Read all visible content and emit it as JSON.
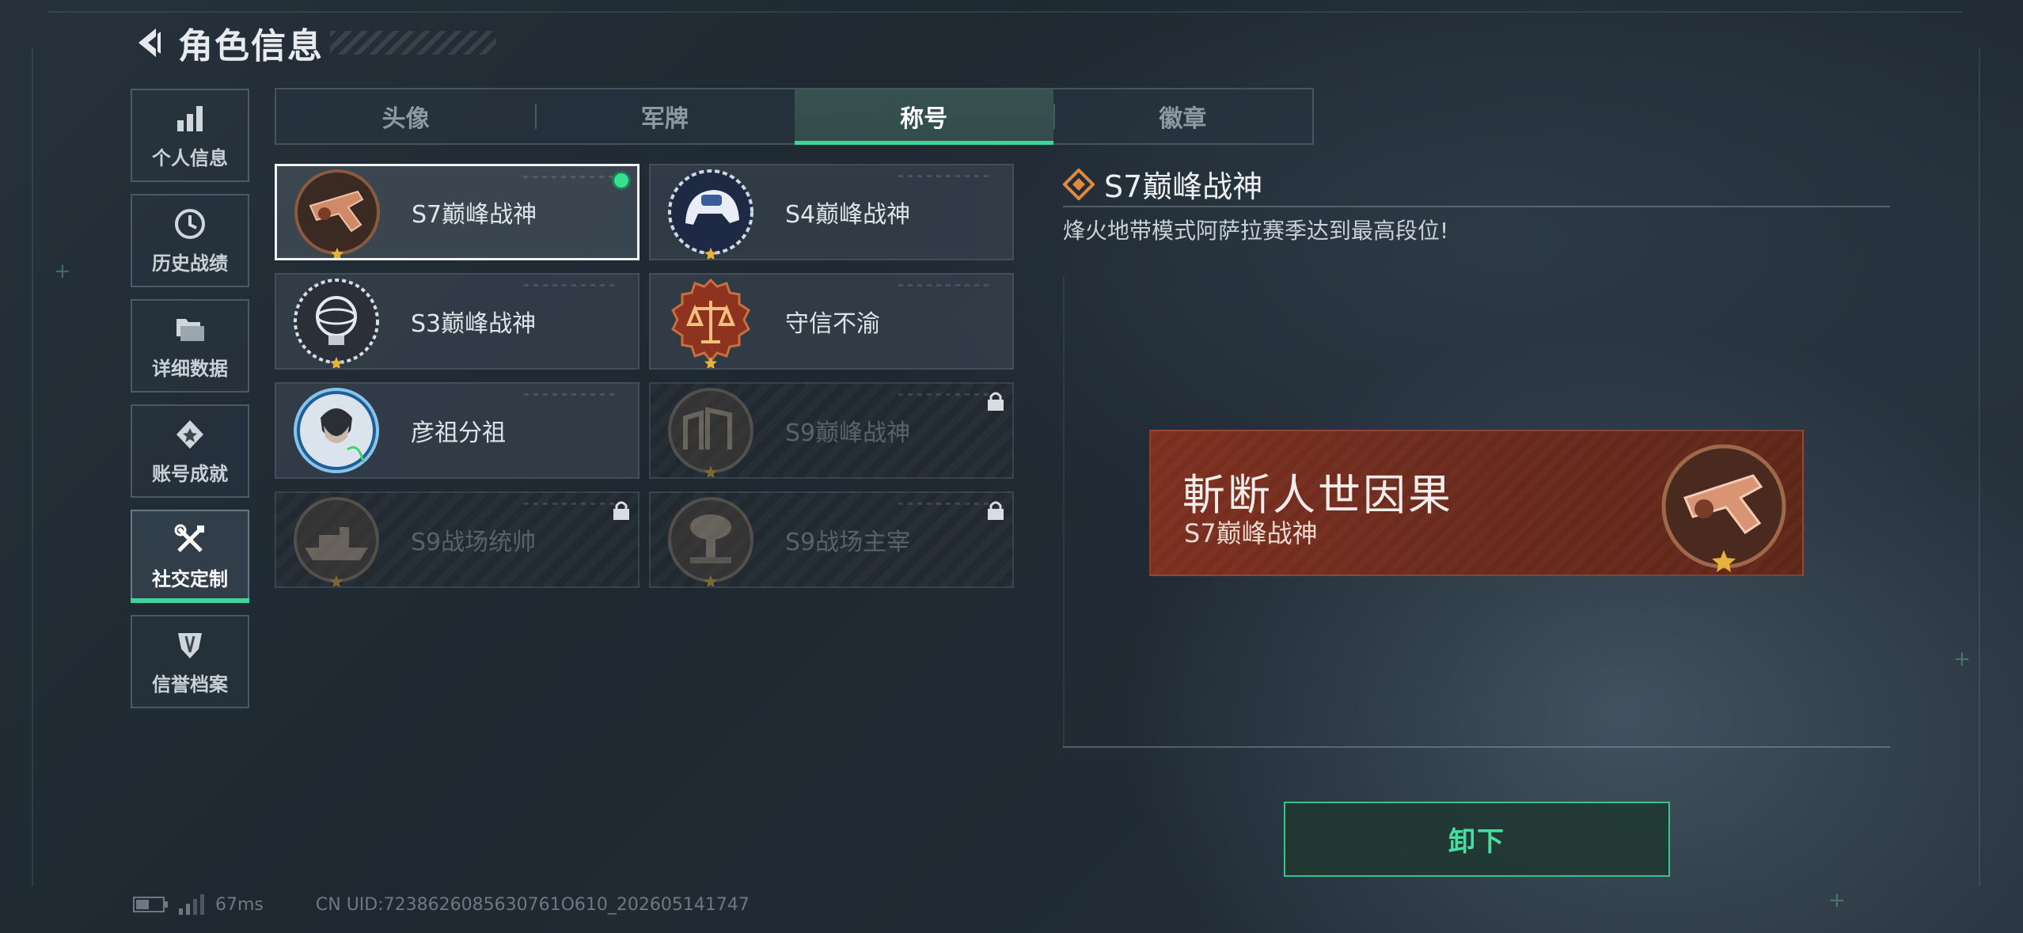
{
  "header": {
    "title": "角色信息"
  },
  "sidebar": {
    "items": [
      {
        "label": "个人信息",
        "icon": "bar-chart-icon",
        "active": false
      },
      {
        "label": "历史战绩",
        "icon": "clock-icon",
        "active": false
      },
      {
        "label": "详细数据",
        "icon": "folder-icon",
        "active": false
      },
      {
        "label": "账号成就",
        "icon": "medal-icon",
        "active": false
      },
      {
        "label": "社交定制",
        "icon": "tools-icon",
        "active": true
      },
      {
        "label": "信誉档案",
        "icon": "shield-icon",
        "active": false
      }
    ]
  },
  "tabs": [
    {
      "label": "头像",
      "active": false
    },
    {
      "label": "军牌",
      "active": false
    },
    {
      "label": "称号",
      "active": true
    },
    {
      "label": "徽章",
      "active": false
    }
  ],
  "titles": [
    {
      "name": "S7巅峰战神",
      "badge": "crossbow-badge-icon",
      "selected": true,
      "equipped": true,
      "locked": false
    },
    {
      "name": "S4巅峰战神",
      "badge": "helmet-badge-icon",
      "selected": false,
      "equipped": false,
      "locked": false
    },
    {
      "name": "S3巅峰战神",
      "badge": "globe-badge-icon",
      "selected": false,
      "equipped": false,
      "locked": false
    },
    {
      "name": "守信不渝",
      "badge": "scales-badge-icon",
      "selected": false,
      "equipped": false,
      "locked": false
    },
    {
      "name": "彦祖分祖",
      "badge": "portrait-badge-icon",
      "selected": false,
      "equipped": false,
      "locked": false
    },
    {
      "name": "S9巅峰战神",
      "badge": "ruins-badge-icon",
      "selected": false,
      "equipped": false,
      "locked": true
    },
    {
      "name": "S9战场统帅",
      "badge": "warship-badge-icon",
      "selected": false,
      "equipped": false,
      "locked": true
    },
    {
      "name": "S9战场主宰",
      "badge": "explosion-badge-icon",
      "selected": false,
      "equipped": false,
      "locked": true
    }
  ],
  "detail": {
    "title": "S7巅峰战神",
    "description": "烽火地带模式阿萨拉赛季达到最高段位!",
    "banner_main": "斬断人世因果",
    "banner_sub": "S7巅峰战神",
    "unequip_label": "卸下"
  },
  "status": {
    "latency": "67ms",
    "uid": "CN UID:7238626085630761O610_202605141747"
  },
  "colors": {
    "accent": "#3fd49a",
    "banner": "#7c2f1f",
    "background": "#222c35"
  }
}
